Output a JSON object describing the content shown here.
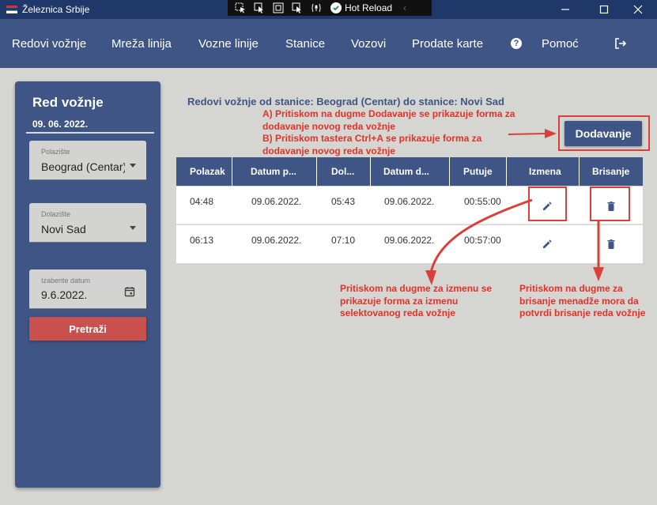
{
  "window": {
    "title": "Železnica Srbije",
    "hot_reload_label": "Hot Reload"
  },
  "menu": {
    "items": [
      "Redovi vožnje",
      "Mreža linija",
      "Vozne linije",
      "Stanice",
      "Vozovi",
      "Prodate karte",
      "Pomoć"
    ]
  },
  "sidebar": {
    "title": "Red vožnje",
    "date": "09. 06. 2022.",
    "from": {
      "label": "Polazište",
      "value": "Beograd (Centar)"
    },
    "to": {
      "label": "Dolazište",
      "value": "Novi Sad"
    },
    "date_field": {
      "label": "Izaberite datum",
      "value": "9.6.2022."
    },
    "search_label": "Pretraži"
  },
  "main": {
    "heading": "Redovi vožnje od stanice: Beograd (Centar) do stanice: Novi Sad",
    "add_label": "Dodavanje",
    "table": {
      "columns": [
        "Polazak",
        "Datum p...",
        "Dol...",
        "Datum d...",
        "Putuje",
        "Izmena",
        "Brisanje"
      ],
      "rows": [
        [
          "04:48",
          "09.06.2022.",
          "05:43",
          "09.06.2022.",
          "00:55:00"
        ],
        [
          "06:13",
          "09.06.2022.",
          "07:10",
          "09.06.2022.",
          "00:57:00"
        ]
      ]
    }
  },
  "annotations": {
    "add_a_1": "A) Pritiskom na dugme Dodavanje se prikazuje forma za",
    "add_a_2": "dodavanje novog reda vožnje",
    "add_b_1": "B) Pritiskom tastera Ctrl+A se prikazuje forma za",
    "add_b_2": "dodavanje novog reda vožnje",
    "edit_1": "Pritiskom na dugme za izmenu se",
    "edit_2": "prikazuje forma za izmenu",
    "edit_3": "selektovanog reda vožnje",
    "delete_1": "Pritiskom na dugme za",
    "delete_2": "brisanje menadže mora da",
    "delete_3": "potvrdi brisanje reda vožnje"
  },
  "colors": {
    "primary": "#3e5585",
    "titlebar": "#1f3769",
    "search_button": "#c9504d",
    "annotation_red": "#e53126",
    "background": "#d5d5d2"
  },
  "icons": [
    "flag-icon",
    "minimize-icon",
    "maximize-icon",
    "close-icon",
    "help-icon",
    "logout-icon",
    "calendar-icon",
    "dropdown-caret-icon",
    "edit-icon",
    "delete-icon"
  ]
}
